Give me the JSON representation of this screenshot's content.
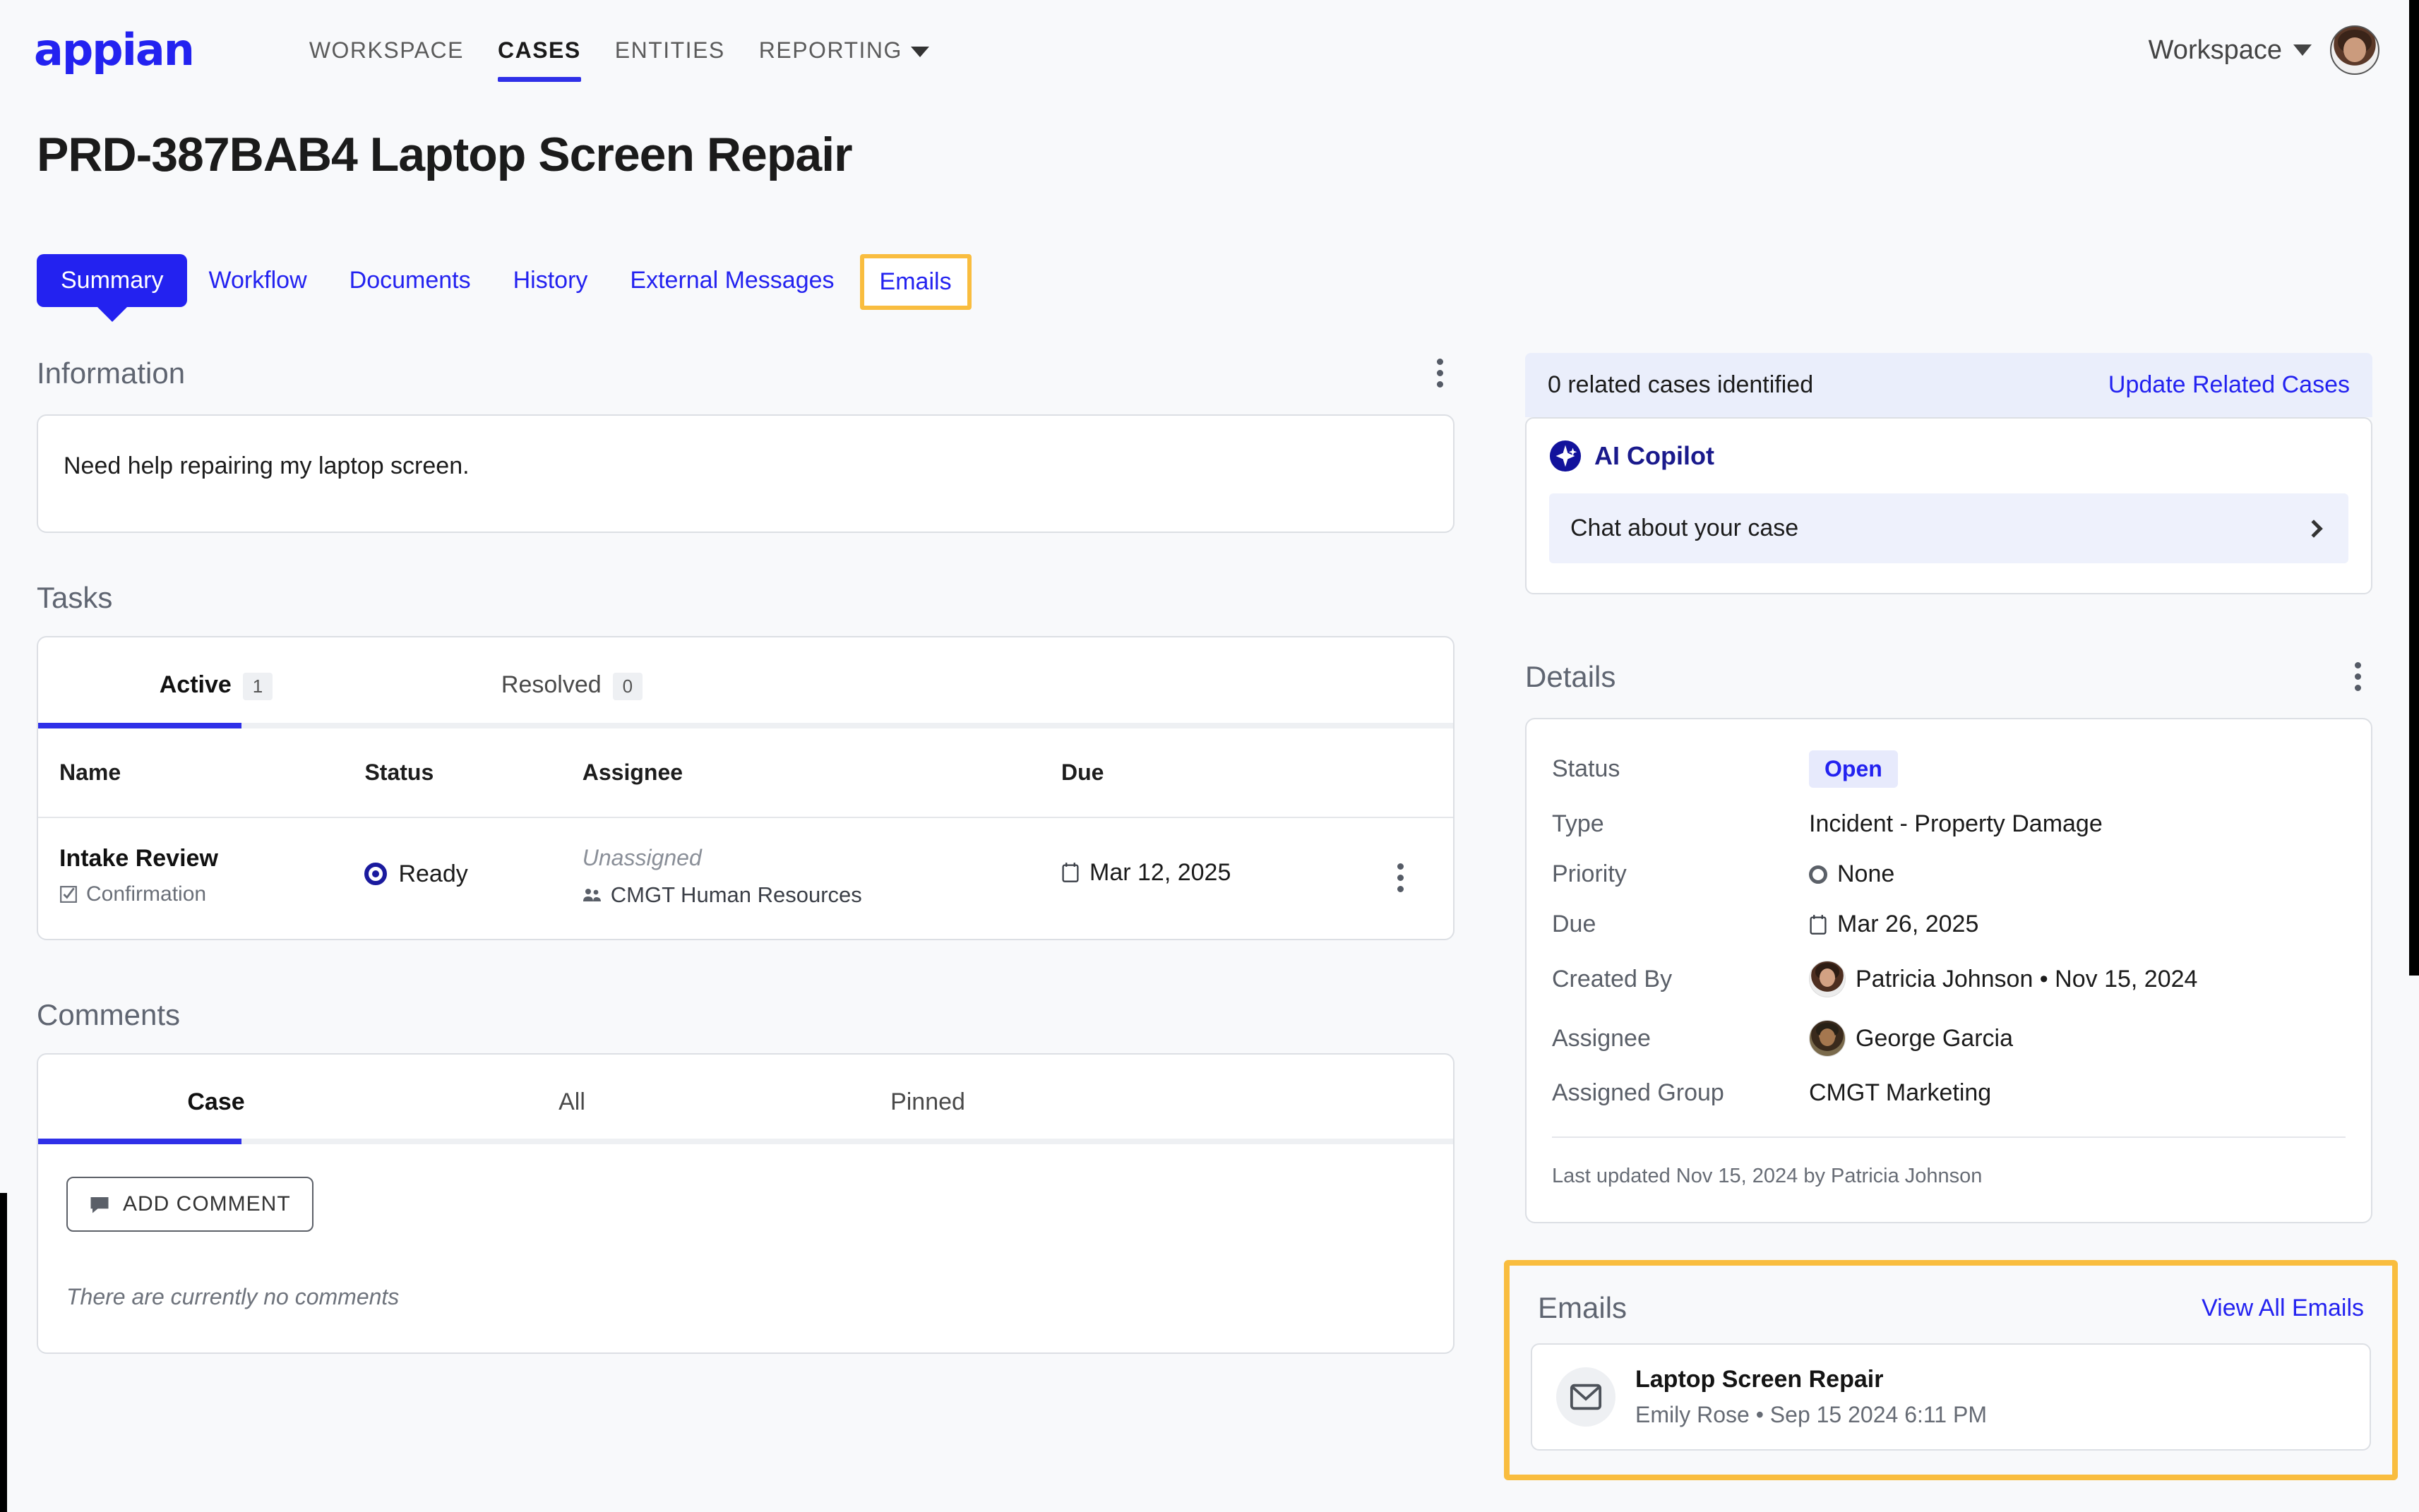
{
  "brand": {
    "logo_text": "appian",
    "accent": "#2322f0",
    "highlight": "#f9bd3f"
  },
  "topnav": {
    "items": [
      {
        "label": "WORKSPACE",
        "active": false
      },
      {
        "label": "CASES",
        "active": true
      },
      {
        "label": "ENTITIES",
        "active": false
      },
      {
        "label": "REPORTING",
        "active": false,
        "has_caret": true
      }
    ],
    "workspace_label": "Workspace"
  },
  "page": {
    "title": "PRD-387BAB4 Laptop Screen Repair"
  },
  "tabs": [
    {
      "label": "Summary",
      "state": "active-pill"
    },
    {
      "label": "Workflow",
      "state": "link"
    },
    {
      "label": "Documents",
      "state": "link"
    },
    {
      "label": "History",
      "state": "link"
    },
    {
      "label": "External Messages",
      "state": "link"
    },
    {
      "label": "Emails",
      "state": "link-highlighted"
    }
  ],
  "information": {
    "heading": "Information",
    "body": "Need help repairing my laptop screen."
  },
  "tasks": {
    "heading": "Tasks",
    "tabs": [
      {
        "label": "Active",
        "count": "1",
        "active": true
      },
      {
        "label": "Resolved",
        "count": "0",
        "active": false
      }
    ],
    "columns": [
      "Name",
      "Status",
      "Assignee",
      "Due"
    ],
    "rows": [
      {
        "name": "Intake Review",
        "subtype": "Confirmation",
        "status": "Ready",
        "assignee": "Unassigned",
        "group": "CMGT Human Resources",
        "due": "Mar 12, 2025"
      }
    ]
  },
  "comments": {
    "heading": "Comments",
    "tabs": [
      {
        "label": "Case",
        "active": true
      },
      {
        "label": "All",
        "active": false
      },
      {
        "label": "Pinned",
        "active": false
      }
    ],
    "add_button": "ADD COMMENT",
    "empty_text": "There are currently no comments"
  },
  "related_cases": {
    "text": "0 related cases identified",
    "action": "Update Related Cases"
  },
  "copilot": {
    "title": "AI Copilot",
    "chat_label": "Chat about your case"
  },
  "details": {
    "heading": "Details",
    "fields": [
      {
        "label": "Status",
        "value": "Open",
        "kind": "badge"
      },
      {
        "label": "Type",
        "value": "Incident - Property Damage",
        "kind": "text"
      },
      {
        "label": "Priority",
        "value": "None",
        "kind": "priority"
      },
      {
        "label": "Due",
        "value": "Mar 26, 2025",
        "kind": "date"
      },
      {
        "label": "Created By",
        "value": "Patricia Johnson • Nov 15, 2024",
        "kind": "person-female"
      },
      {
        "label": "Assignee",
        "value": "George Garcia",
        "kind": "person-male"
      },
      {
        "label": "Assigned Group",
        "value": "CMGT Marketing",
        "kind": "text"
      }
    ],
    "last_updated": "Last updated Nov 15, 2024 by Patricia Johnson"
  },
  "emails": {
    "heading": "Emails",
    "view_all": "View All Emails",
    "items": [
      {
        "subject": "Laptop Screen Repair",
        "meta": "Emily Rose  •  Sep 15 2024 6:11 PM"
      }
    ]
  }
}
